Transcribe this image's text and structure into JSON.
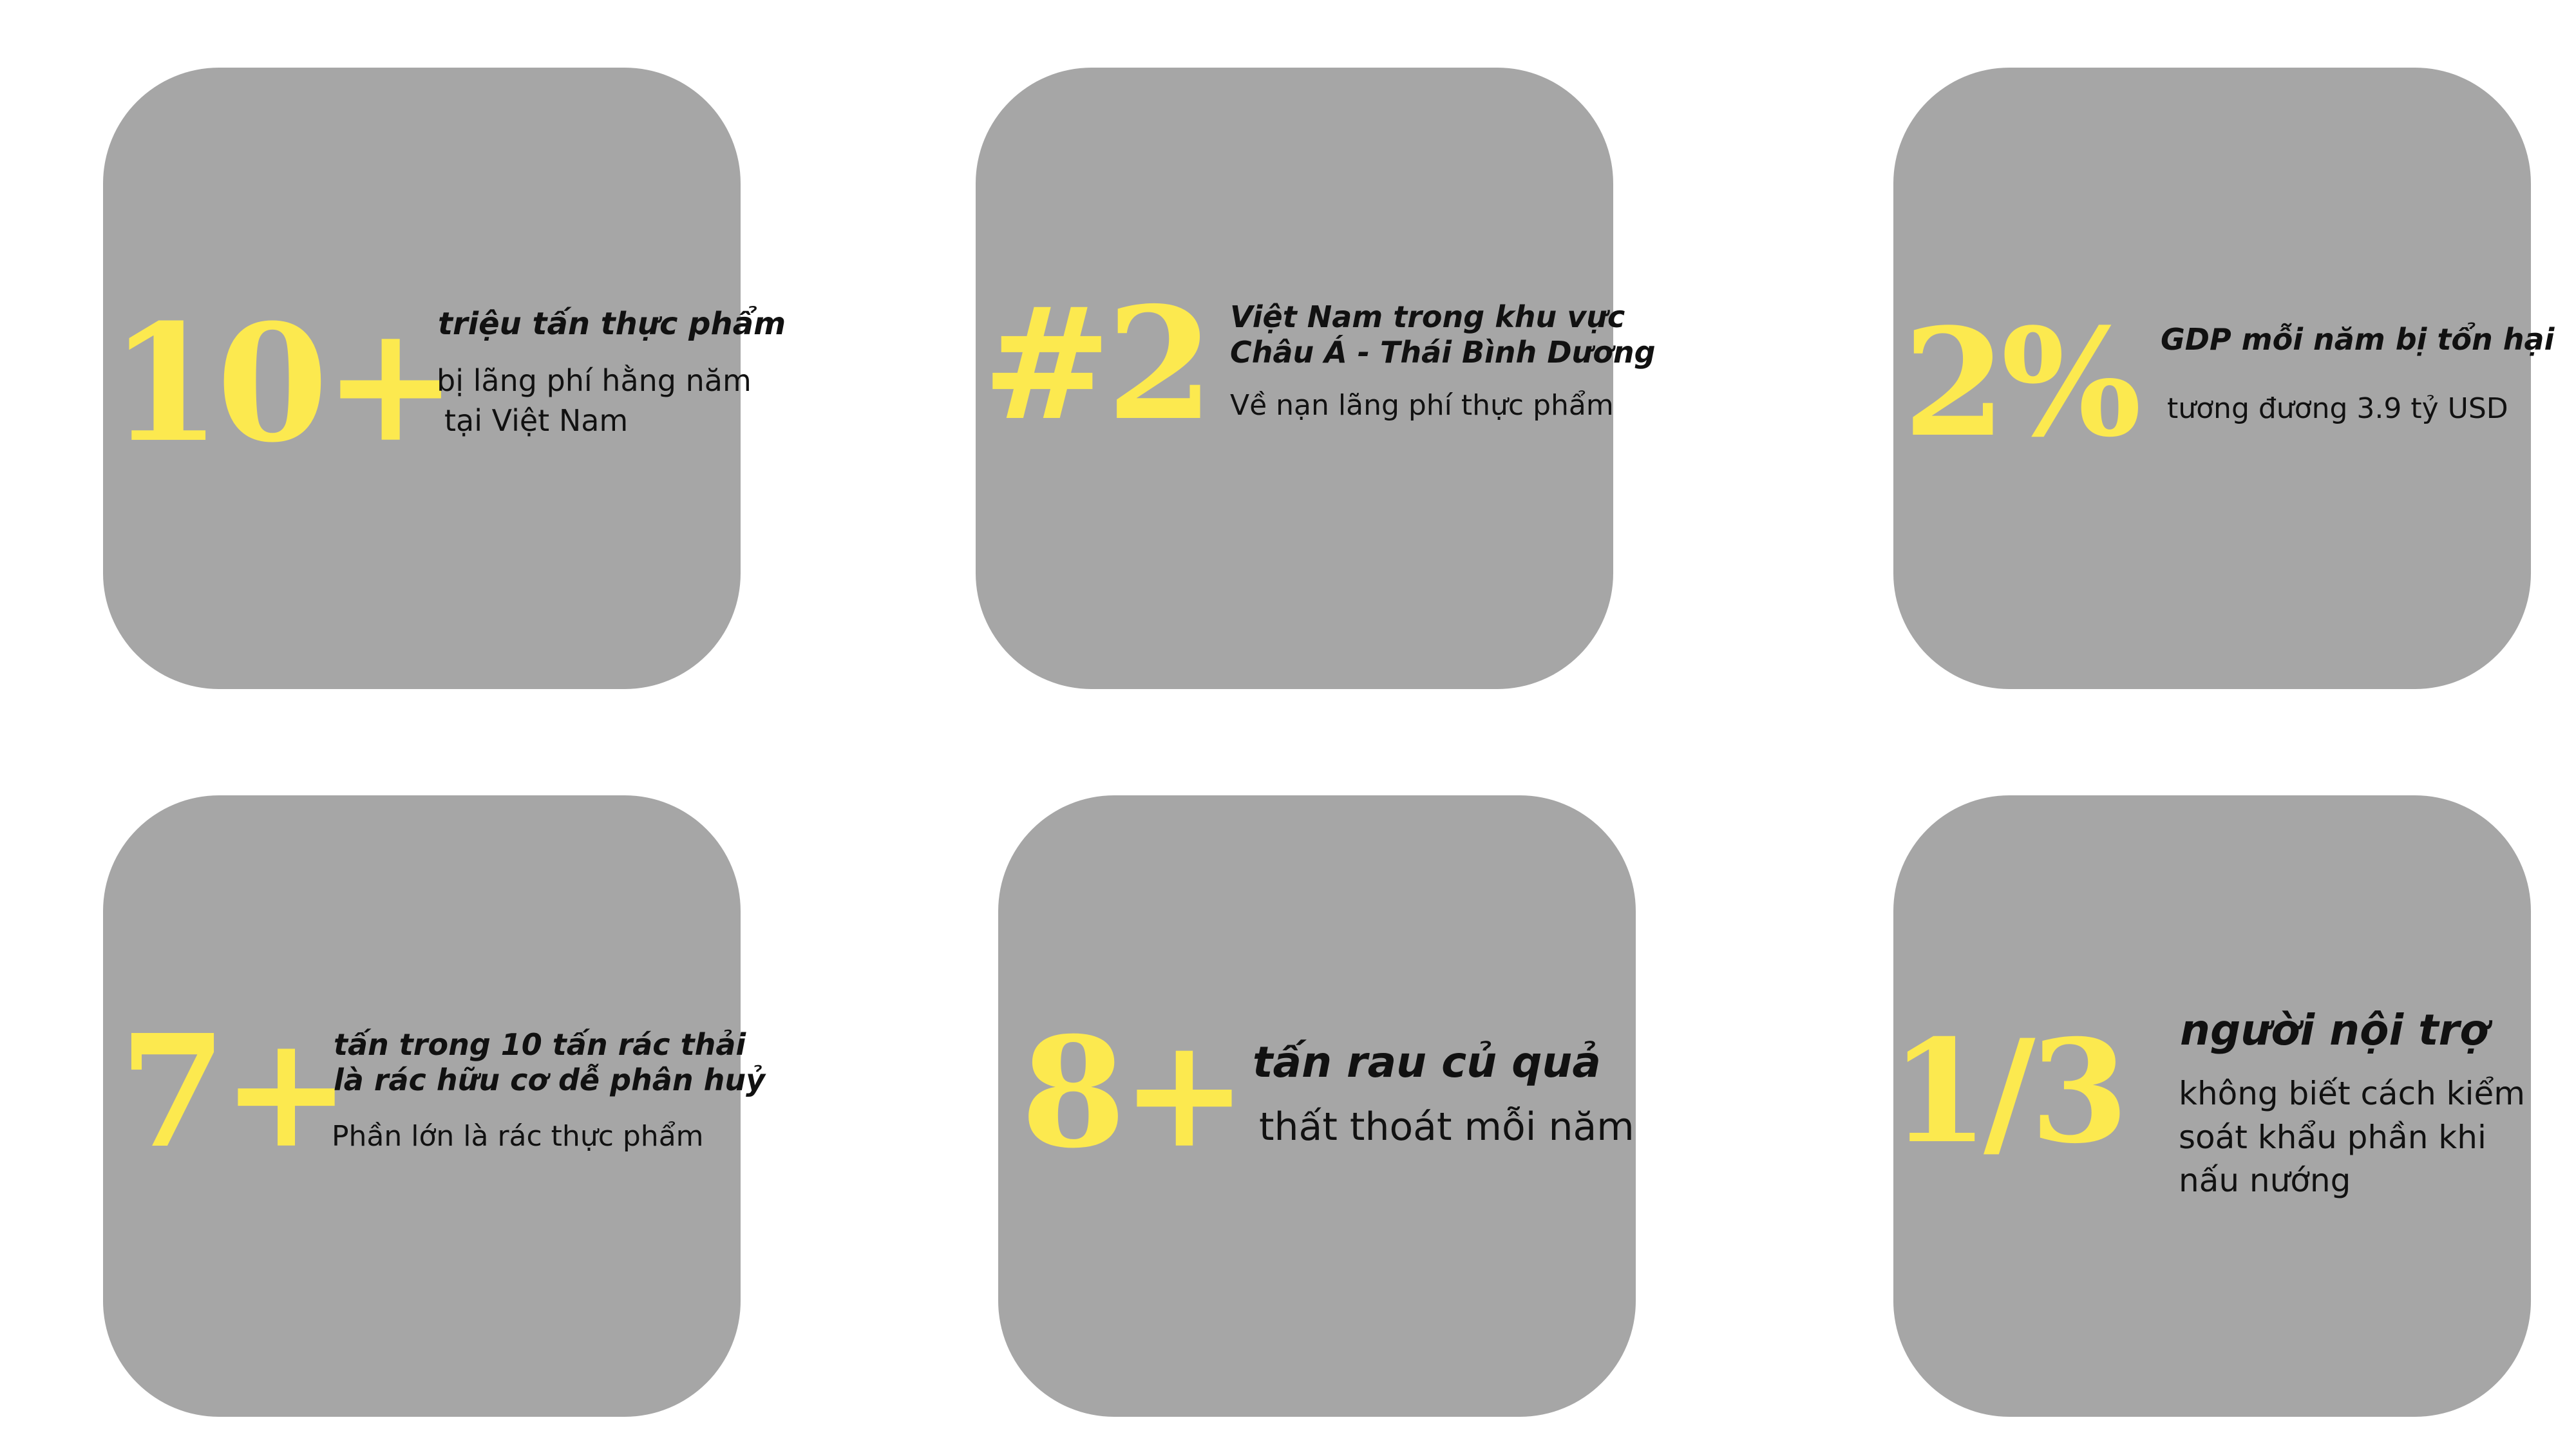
{
  "colors": {
    "card": "#a6a6a6",
    "number": "#fce94f",
    "text": "#111111",
    "background": "#ffffff"
  },
  "stats": [
    {
      "number": "10+",
      "heading": [
        "triệu tấn thực phẩm"
      ],
      "body": [
        "bị lãng phí hằng năm",
        "tại Việt Nam"
      ]
    },
    {
      "number": "#2",
      "heading": [
        "Việt Nam trong khu vực",
        "Châu Á  - Thái Bình Dương"
      ],
      "body": [
        "Về nạn lãng phí thực phẩm"
      ]
    },
    {
      "number": "2%",
      "heading": [
        "GDP mỗi năm bị tổn hại"
      ],
      "body": [
        "tương đương 3.9 tỷ USD"
      ]
    },
    {
      "number": "7+",
      "heading": [
        "tấn trong 10 tấn rác thải",
        "là rác hữu cơ dễ phân huỷ"
      ],
      "body": [
        "Phần lớn là rác thực phẩm"
      ]
    },
    {
      "number": "8+",
      "heading": [
        "tấn rau củ quả"
      ],
      "body": [
        "thất thoát mỗi năm"
      ]
    },
    {
      "number": "1/3",
      "heading": [
        "người nội trợ"
      ],
      "body": [
        "không biết cách kiểm",
        "soát khẩu phần khi",
        "nấu nướng"
      ]
    }
  ]
}
